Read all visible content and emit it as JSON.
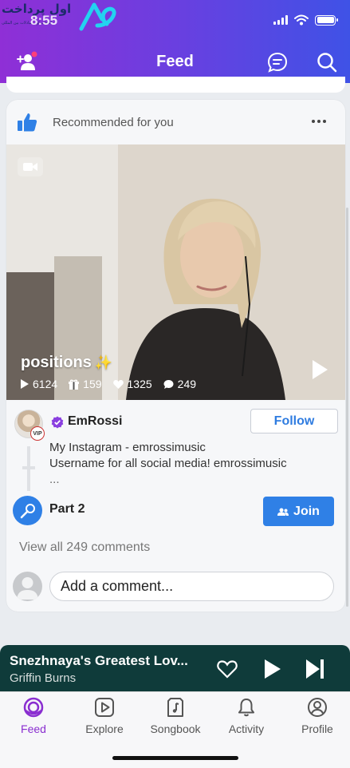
{
  "status_bar": {
    "time": "8:55",
    "watermark_text": "اول پرداخت",
    "watermark_subtext": "انتخاب اول مبادلات بین المللی"
  },
  "header": {
    "title": "Feed",
    "icons": [
      "add-friend-icon",
      "messages-icon",
      "search-icon"
    ]
  },
  "card": {
    "header_label": "Recommended for you",
    "icons": [
      "thumbs-up-icon",
      "more-icon"
    ],
    "video": {
      "title": "positions",
      "title_emoji": "✨",
      "stats": {
        "plays": "6124",
        "gifts": "159",
        "likes": "1325",
        "comments": "249"
      }
    },
    "post": {
      "username": "EmRossi",
      "badge": "VIP",
      "follow_label": "Follow",
      "bio_line1": "My Instagram - emrossimusic",
      "bio_line2": "Username for all social media! emrossimusic",
      "bio_more": "...",
      "part_label": "Part 2",
      "join_label": "Join",
      "view_comments": "View all 249 comments",
      "comment_placeholder": "Add a comment..."
    }
  },
  "mini_player": {
    "title": "Snezhnaya's Greatest Lov...",
    "artist": "Griffin Burns",
    "icons": [
      "heart-icon",
      "play-icon",
      "skip-next-icon"
    ],
    "background": "#0f3b3a"
  },
  "tabs": [
    {
      "label": "Feed",
      "icon": "feed-icon",
      "active": true
    },
    {
      "label": "Explore",
      "icon": "explore-icon",
      "active": false
    },
    {
      "label": "Songbook",
      "icon": "songbook-icon",
      "active": false
    },
    {
      "label": "Activity",
      "icon": "bell-icon",
      "active": false
    },
    {
      "label": "Profile",
      "icon": "profile-icon",
      "active": false
    }
  ],
  "colors": {
    "header_gradient_start": "#8f2fd6",
    "header_gradient_end": "#3f52e6",
    "accent_blue": "#2f80e6",
    "active_tab": "#8a2ed0"
  }
}
